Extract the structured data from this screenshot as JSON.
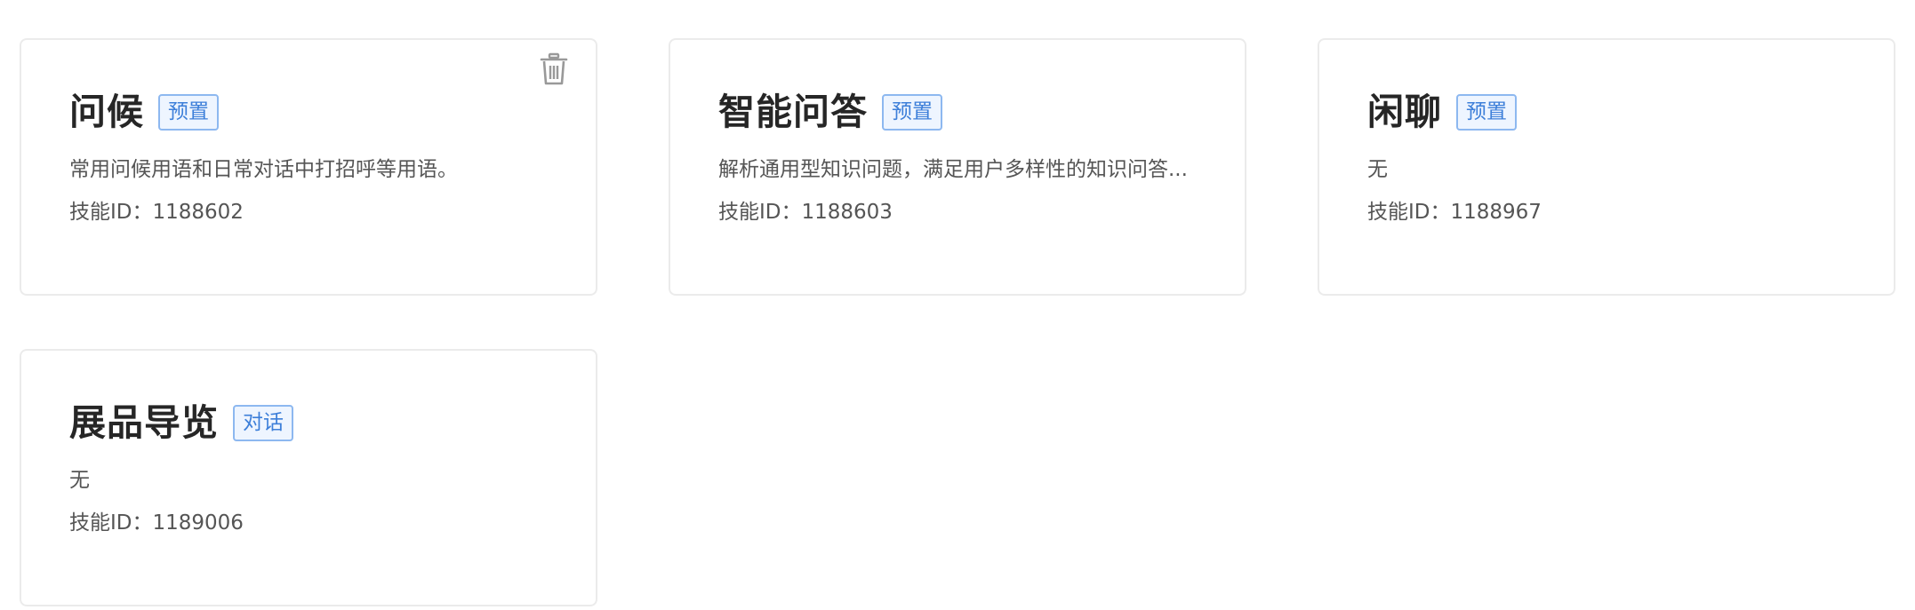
{
  "skills": [
    {
      "title": "问候",
      "tag": "预置",
      "description": "常用问候用语和日常对话中打招呼等用语。",
      "id_text": "技能ID：1188602",
      "delete_icon": "trash-icon"
    },
    {
      "title": "智能问答",
      "tag": "预置",
      "description": "解析通用型知识问题，满足用户多样性的知识问答...",
      "id_text": "技能ID：1188603"
    },
    {
      "title": "闲聊",
      "tag": "预置",
      "description": "无",
      "id_text": "技能ID：1188967"
    },
    {
      "title": "展品导览",
      "tag": "对话",
      "description": "无",
      "id_text": "技能ID：1189006"
    }
  ],
  "colors": {
    "tag_border": "#8db8f0",
    "tag_text": "#3d7fd9",
    "card_border": "#ebebeb"
  }
}
